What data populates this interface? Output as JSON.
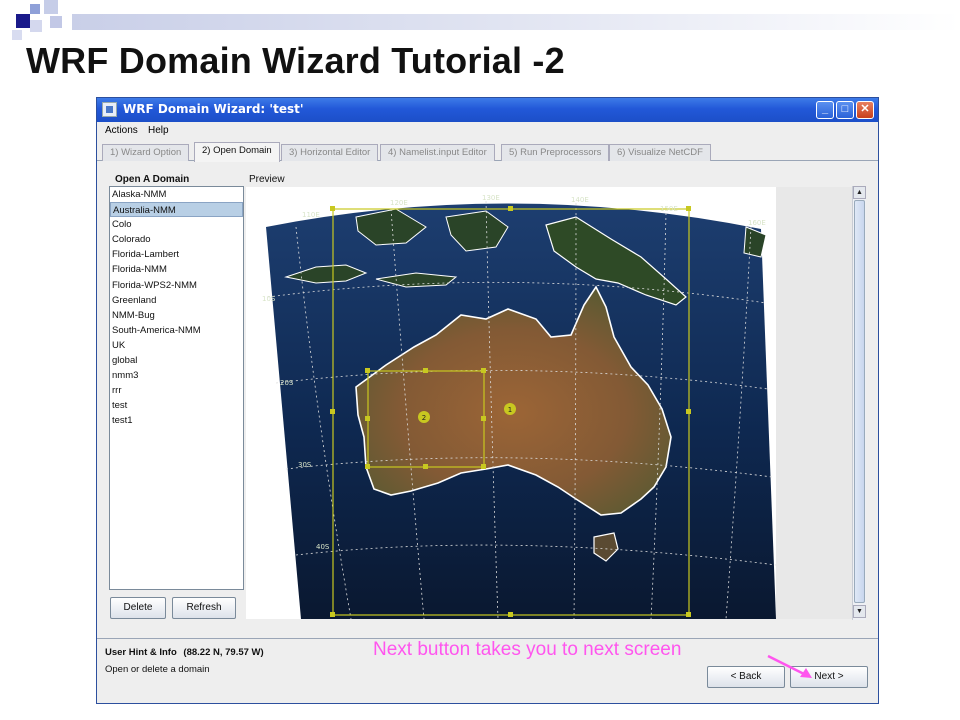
{
  "slide": {
    "title": "WRF Domain Wizard Tutorial -2",
    "callout": "Next button takes you to next screen"
  },
  "window": {
    "title": "WRF Domain Wizard: 'test'",
    "buttons": {
      "minimize": "_",
      "maximize": "□",
      "close": "✕"
    }
  },
  "menu": [
    "Actions",
    "Help"
  ],
  "tabs": [
    {
      "label": "1) Wizard Option"
    },
    {
      "label": "2) Open Domain"
    },
    {
      "label": "3) Horizontal Editor"
    },
    {
      "label": "4) Namelist.input Editor"
    },
    {
      "label": "5) Run Preprocessors"
    },
    {
      "label": "6) Visualize NetCDF"
    }
  ],
  "open_domain": {
    "title": "Open A Domain",
    "items": [
      "Alaska-NMM",
      "Australia-NMM",
      "Colo",
      "Colorado",
      "Florida-Lambert",
      "Florida-NMM",
      "Florida-WPS2-NMM",
      "Greenland",
      "NMM-Bug",
      "South-America-NMM",
      "UK",
      "global",
      "nmm3",
      "rrr",
      "test",
      "test1"
    ],
    "selected": "Australia-NMM",
    "delete_label": "Delete",
    "refresh_label": "Refresh"
  },
  "preview": {
    "label": "Preview",
    "lon_labels": [
      "110E",
      "120E",
      "130E",
      "140E",
      "150E",
      "160E"
    ],
    "lat_labels": [
      "10S",
      "20S",
      "30S",
      "40S"
    ],
    "domain_markers": [
      "1",
      "2"
    ],
    "colors": {
      "ocean": "#0e1e3a",
      "land": "#8a5a32",
      "grid": "#dddddd",
      "domain_box": "#c8c820",
      "coast": "#ffffff"
    }
  },
  "hint": {
    "title": "User Hint & Info",
    "coords": "(88.22 N, 79.57 W)",
    "text": "Open or delete a domain"
  },
  "nav": {
    "back_label": "< Back",
    "next_label": "Next >"
  },
  "colors": {
    "accent": "#2258d8",
    "callout": "#ff55ee"
  }
}
